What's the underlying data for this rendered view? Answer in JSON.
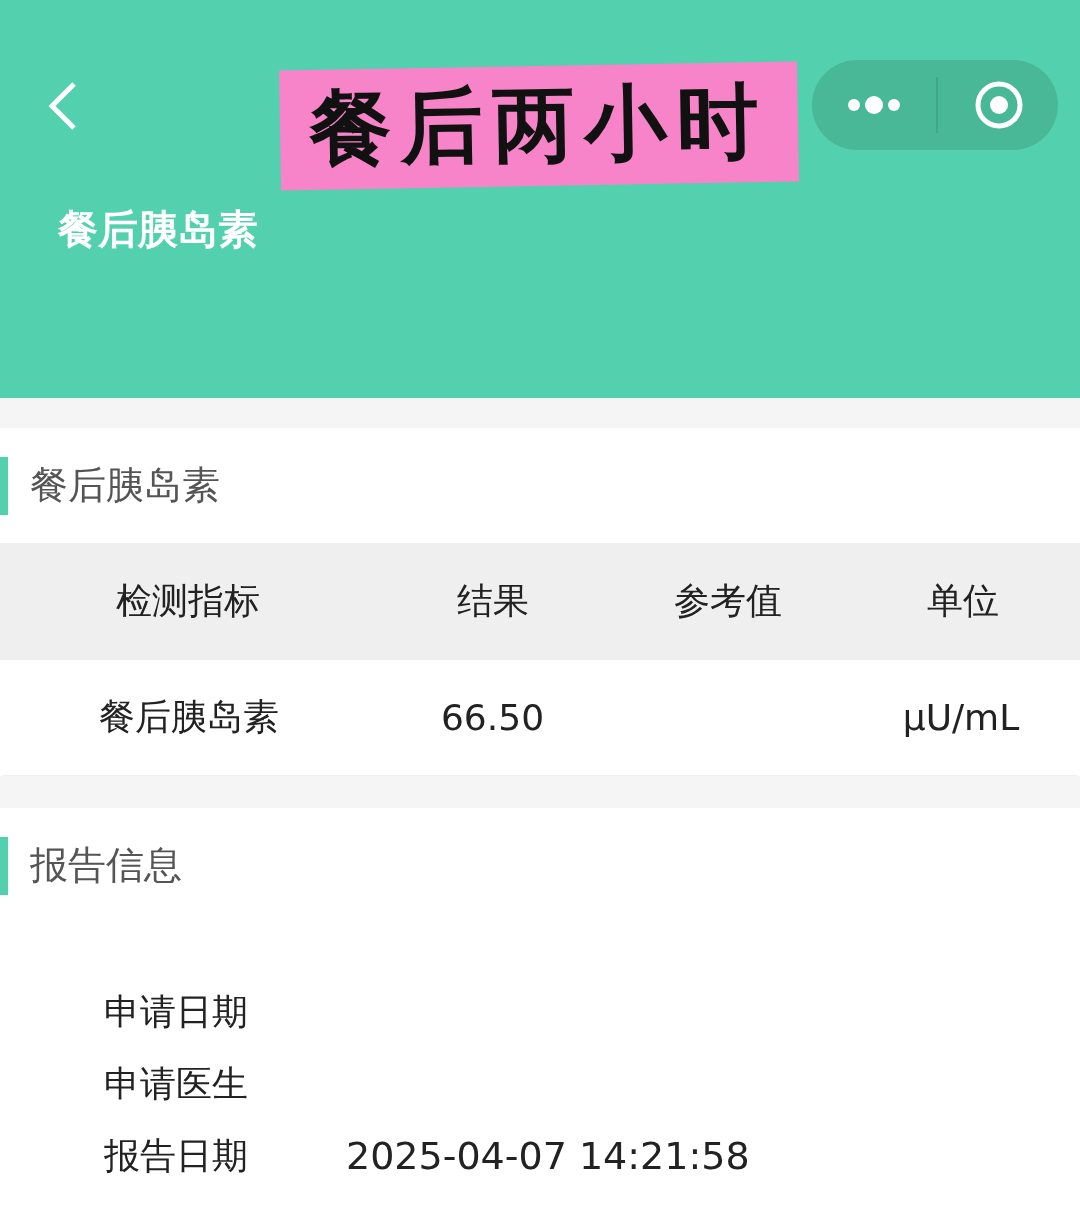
{
  "header": {
    "title": "餐后胰岛素",
    "sticker": "餐后两小时"
  },
  "result_section": {
    "heading": "餐后胰岛素",
    "table": {
      "columns": [
        "检测指标",
        "结果",
        "参考值",
        "单位"
      ],
      "rows": [
        {
          "indicator": "餐后胰岛素",
          "result": "66.50",
          "unit": "µU/mL"
        }
      ]
    }
  },
  "report_section": {
    "heading": "报告信息",
    "fields": [
      {
        "label": "申请日期"
      },
      {
        "label": "申请医生"
      },
      {
        "label": "报告日期",
        "value": "2025-04-07 14:21:58"
      }
    ]
  }
}
